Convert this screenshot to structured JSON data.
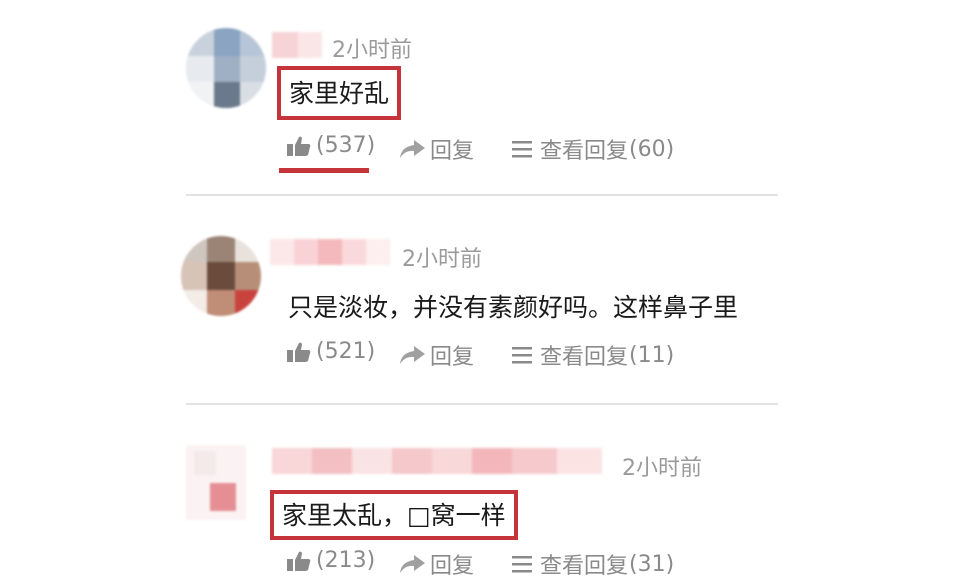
{
  "colors": {
    "highlight": "#c6343b",
    "meta_text": "#8a8a8a",
    "divider": "#e2e2e2"
  },
  "comments": [
    {
      "time": "2小时前",
      "content": "家里好乱",
      "like_count": "(537)",
      "reply_label": "回复",
      "view_replies_label": "查看回复",
      "reply_count": "(60)",
      "highlighted": true
    },
    {
      "time": "2小时前",
      "content": "只是淡妆，并没有素颜好吗。这样鼻子里",
      "like_count": "(521)",
      "reply_label": "回复",
      "view_replies_label": "查看回复",
      "reply_count": "(11)",
      "highlighted": false
    },
    {
      "time": "2小时前",
      "content": "家里太乱，□窝一样",
      "like_count": "(213)",
      "reply_label": "回复",
      "view_replies_label": "查看回复",
      "reply_count": "(31)",
      "highlighted": true
    }
  ],
  "icons": {
    "like": "thumbs-up-icon",
    "reply": "share-arrow-icon",
    "view_replies": "list-icon"
  }
}
